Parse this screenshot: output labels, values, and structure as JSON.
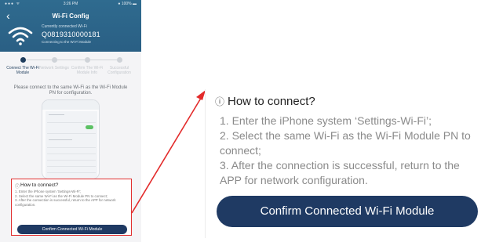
{
  "phone": {
    "status": {
      "carrier": "●●● ᯤ",
      "time": "3:26 PM",
      "battery": "● 100% ▬"
    },
    "nav": {
      "title": "Wi-Fi Config"
    },
    "connection": {
      "label": "Currently connected Wi-Fi",
      "id": "Q0819310000181",
      "sub": "Connecting to the Wi-Fi Module"
    },
    "steps": [
      {
        "label": "Connect The Wi-Fi Module",
        "active": true
      },
      {
        "label": "Network Settings",
        "active": false
      },
      {
        "label": "Confirm The Wi-Fi Module Info",
        "active": false
      },
      {
        "label": "Successful Configuration",
        "active": false
      }
    ],
    "instruction": "Please connect to the same Wi-Fi as the Wi-Fi Module PN for configuration.",
    "how_to_connect": {
      "title": "How to connect?",
      "steps": "1. Enter the iPhone system 'Settings-Wi-Fi';\n2. Select the same Wi-Fi as the Wi-Fi Module PN to connect;\n3. After the connection is successful, return to the APP for network configuration."
    },
    "confirm_button": "Confirm Connected Wi-Fi Module"
  },
  "zoom": {
    "how_icon": "ⓘ",
    "title": "How to connect?",
    "step1": "1. Enter the iPhone system ‘Settings-Wi-Fi’;",
    "step2": "2. Select the same Wi-Fi as the Wi-Fi Module PN to connect;",
    "step3": "3. After the connection is successful, return to the APP for network configuration.",
    "confirm_button": "Confirm Connected Wi-Fi Module"
  },
  "colors": {
    "header": "#2a5f84",
    "accent_button": "#1f3a63",
    "highlight": "#e23030",
    "active_step": "#1f3d5c"
  },
  "icons": {
    "back": "chevron-left-icon",
    "wifi": "wifi-icon",
    "info": "info-icon"
  }
}
